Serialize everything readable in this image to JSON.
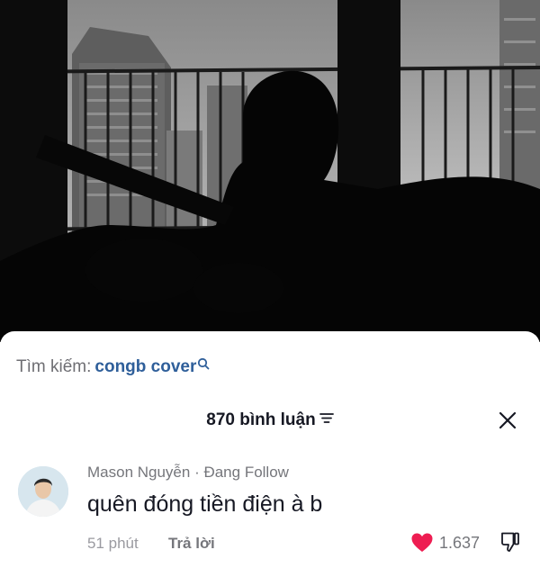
{
  "search": {
    "prefix": "Tìm kiếm:",
    "term": "congb cover"
  },
  "comments_header": {
    "count_label": "870 bình luận"
  },
  "comment": {
    "author": "Mason Nguyễn · Đang Follow",
    "text": "quên đóng tiền điện à b",
    "time": "51 phút",
    "reply_label": "Trả lời",
    "like_count": "1.637",
    "liked": true
  },
  "colors": {
    "search_term": "#2f5f9a",
    "like_heart": "#ee1d52",
    "primary_text": "#161823",
    "secondary_text": "#75767b"
  },
  "icons": {
    "search": "search-icon",
    "sort": "sort-icon",
    "close": "close-icon",
    "like": "heart-icon",
    "dislike": "thumbs-down-icon"
  }
}
